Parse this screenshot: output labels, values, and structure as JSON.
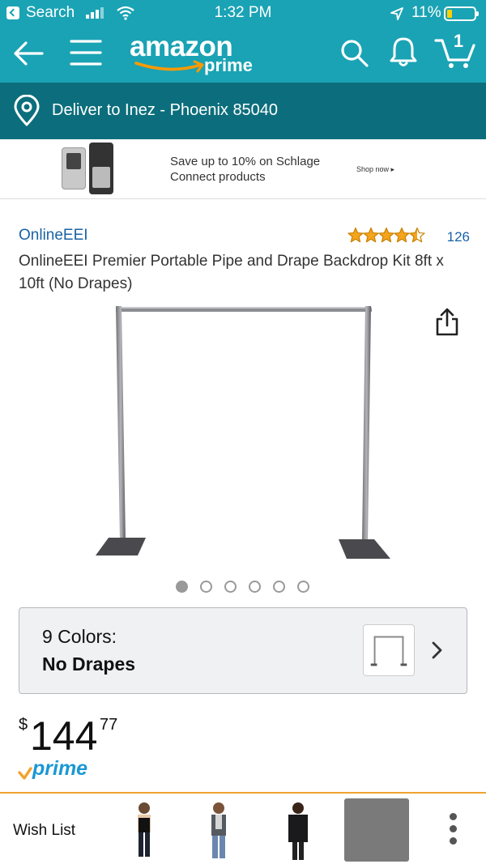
{
  "status_bar": {
    "back_app": "Search",
    "time": "1:32 PM",
    "battery": "11%"
  },
  "nav": {
    "logo_word": "amazon",
    "logo_sub": "prime",
    "cart_count": "1",
    "icons": [
      "back-arrow-icon",
      "menu-icon",
      "search-icon",
      "bell-icon",
      "cart-icon"
    ]
  },
  "delivery": {
    "text": "Deliver to Inez - Phoenix 85040"
  },
  "ad": {
    "text": "Save up to 10% on Schlage Connect products",
    "cta": "Shop now ▸"
  },
  "product": {
    "brand": "OnlineEEI",
    "rating": 4.5,
    "rating_count": "126",
    "title": "OnlineEEI Premier Portable Pipe and Drape Backdrop Kit 8ft x 10ft (No Drapes)",
    "image_count": 6,
    "active_image": 0
  },
  "variant": {
    "label": "9 Colors:",
    "value": "No Drapes"
  },
  "price": {
    "symbol": "$",
    "whole": "144",
    "fraction": "77"
  },
  "prime_label": "prime",
  "bottom": {
    "wish_list": "Wish List"
  },
  "colors": {
    "teal": "#1aa3b4",
    "deliver_bg": "#0c6e7c",
    "link": "#1a63a6",
    "star": "#f4a41d",
    "prime": "#1a98d5",
    "divider": "#f0a330"
  }
}
